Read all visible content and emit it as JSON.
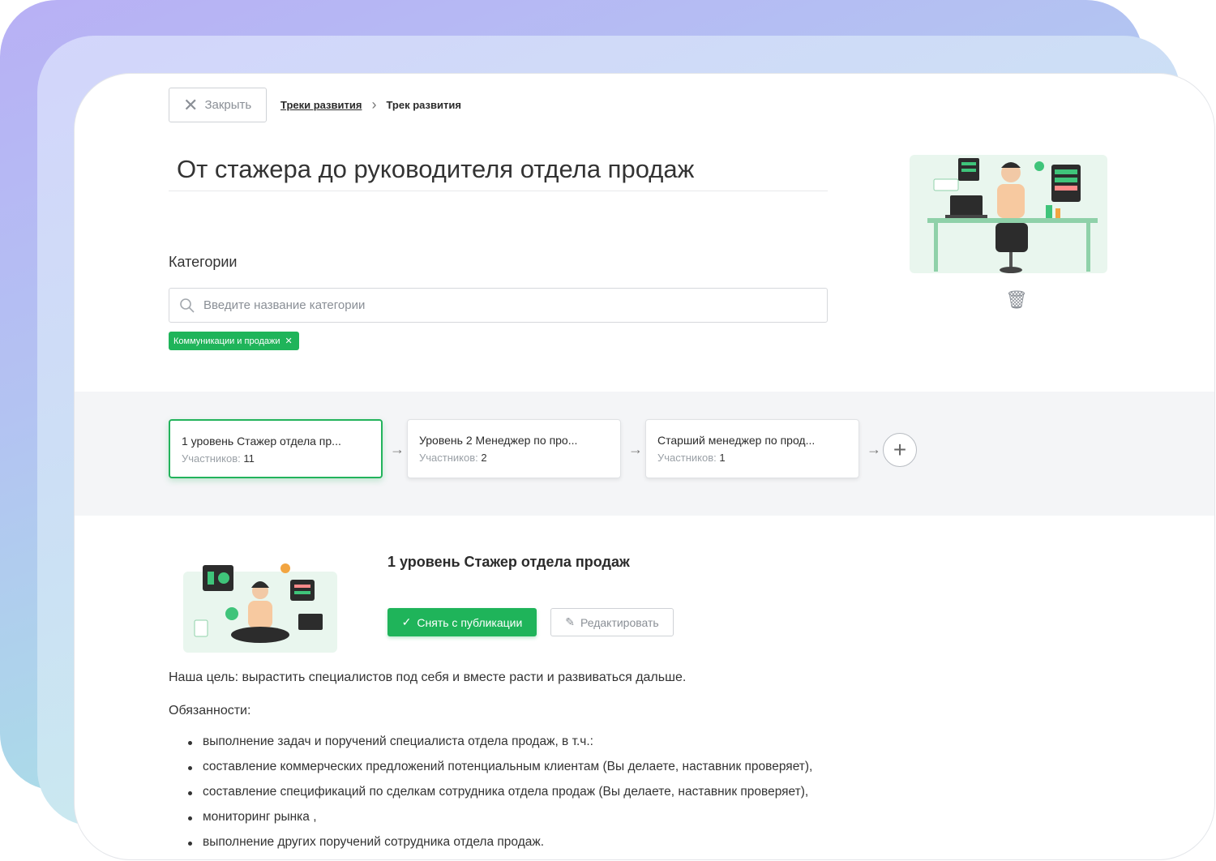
{
  "header": {
    "close_label": "Закрыть",
    "breadcrumb_link": "Треки развития",
    "breadcrumb_current": "Трек развития"
  },
  "track": {
    "title": "От стажера до руководителя отдела продаж"
  },
  "categories": {
    "label": "Категории",
    "search_placeholder": "Введите название категории",
    "selected_tag": "Коммуникации и продажи"
  },
  "levels": [
    {
      "name": "1 уровень Стажер отдела пр...",
      "participants_label": "Участников:",
      "participants": "11"
    },
    {
      "name": "Уровень 2 Менеджер по про...",
      "participants_label": "Участников:",
      "participants": "2"
    },
    {
      "name": "Старший менеджер по прод...",
      "participants_label": "Участников:",
      "participants": "1"
    }
  ],
  "detail": {
    "title": "1 уровень Стажер отдела продаж",
    "unpublish_label": "Снять с публикации",
    "edit_label": "Редактировать",
    "goal": "Наша цель: вырастить специалистов под себя и вместе расти и развиваться дальше.",
    "duties_heading": "Обязанности:",
    "duties": [
      "выполнение задач и поручений специалиста отдела продаж, в т.ч.:",
      "составление коммерческих предложений потенциальным клиентам (Вы делаете, наставник проверяет),",
      "составление спецификаций по сделкам сотрудника отдела продаж (Вы делаете, наставник проверяет),",
      "мониторинг рынка  ,",
      "выполнение других поручений сотрудника отдела продаж."
    ]
  },
  "colors": {
    "accent_green": "#1fb45a",
    "text": "#2b2b2b",
    "muted": "#8a8f96"
  }
}
